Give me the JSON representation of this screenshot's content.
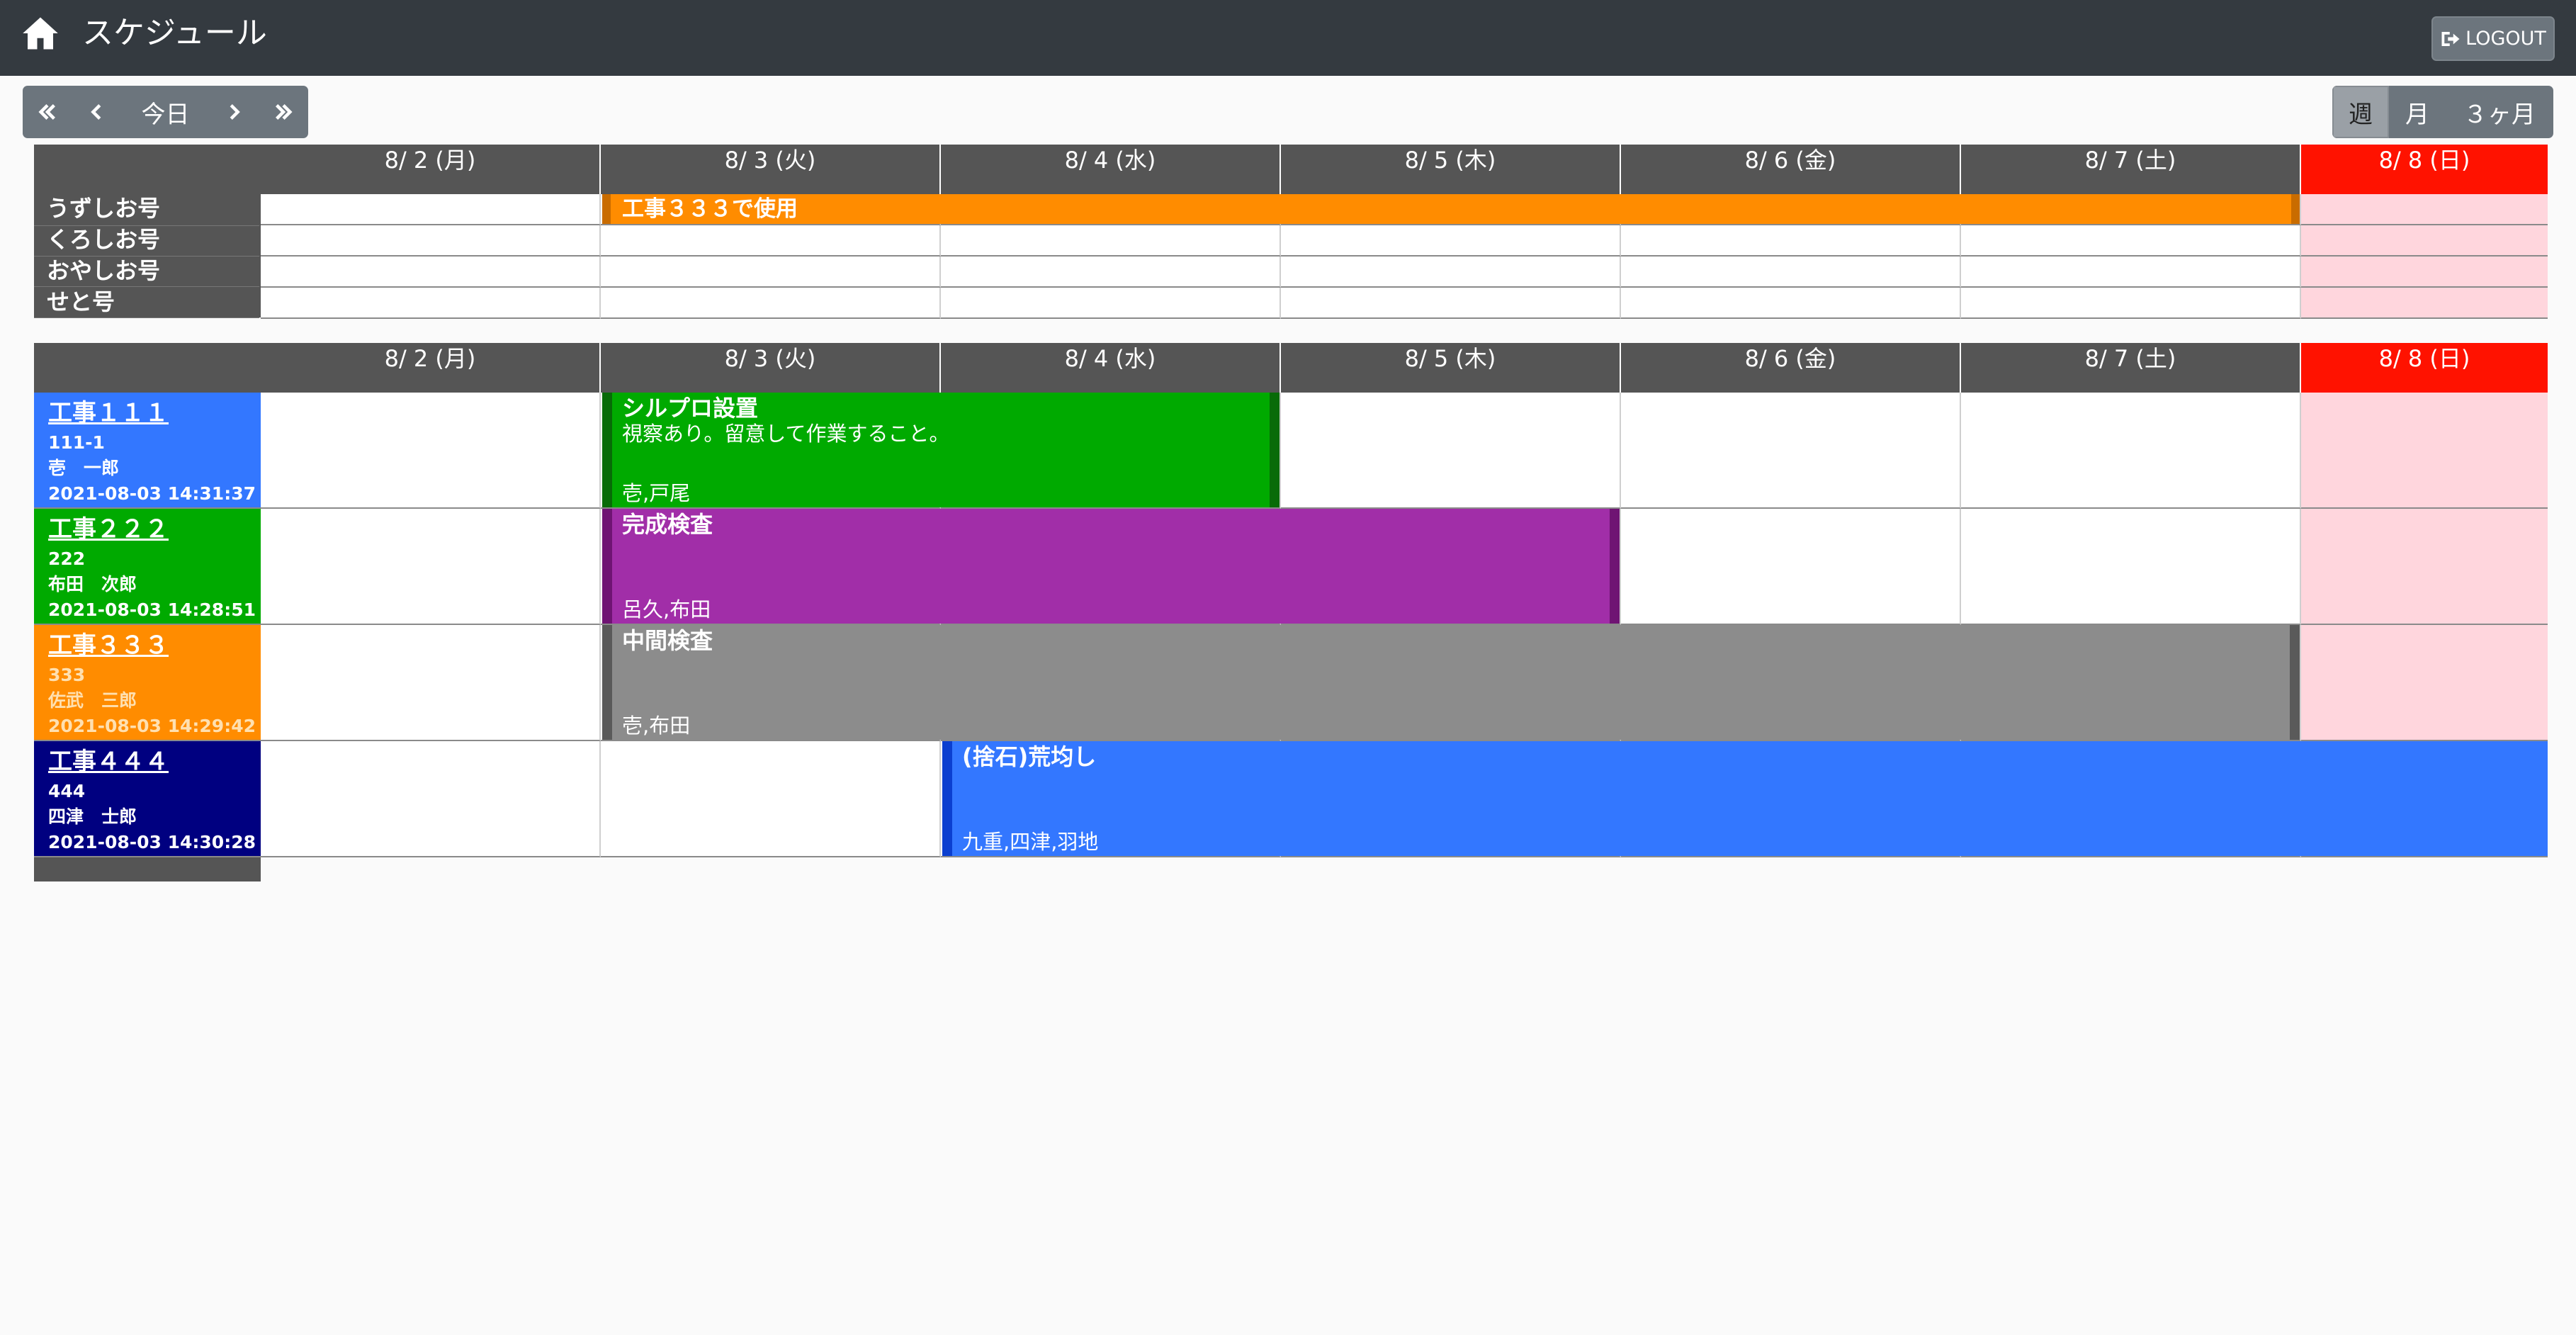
{
  "header": {
    "title": "スケジュール",
    "logout_label": "LOGOUT"
  },
  "toolbar": {
    "today_label": "今日",
    "views": [
      "週",
      "月",
      "３ヶ月"
    ],
    "active_view": "週"
  },
  "days": [
    "8/ 2 (月)",
    "8/ 3 (火)",
    "8/ 4 (水)",
    "8/ 5 (木)",
    "8/ 6 (金)",
    "8/ 7 (土)",
    "8/ 8 (日)"
  ],
  "resources": [
    "うずしお号",
    "くろしお号",
    "おやしお号",
    "せと号"
  ],
  "resource_events": [
    {
      "title": "工事３３３で使用",
      "color": "#ff8c00"
    }
  ],
  "projects": [
    {
      "name": "工事１１１",
      "code": "111-1",
      "person": "壱　一郎",
      "timestamp": "2021-08-03 14:31:37",
      "color": "#3377ff",
      "text_color": "#ffffff"
    },
    {
      "name": "工事２２２",
      "code": "222",
      "person": "布田　次郎",
      "timestamp": "2021-08-03 14:28:51",
      "color": "#00aa00",
      "text_color": "#ffffff"
    },
    {
      "name": "工事３３３",
      "code": "333",
      "person": "佐武　三郎",
      "timestamp": "2021-08-03 14:29:42",
      "color": "#ff8c00",
      "text_color": "#ffe0b0"
    },
    {
      "name": "工事４４４",
      "code": "444",
      "person": "四津　士郎",
      "timestamp": "2021-08-03 14:30:28",
      "color": "#000080",
      "text_color": "#ffffff"
    }
  ],
  "project_events": [
    {
      "title": "シルプロ設置",
      "note": "視察あり。留意して作業すること。",
      "people": "壱,戸尾",
      "color": "#00aa00"
    },
    {
      "title": "完成検査",
      "note": "",
      "people": "呂久,布田",
      "color": "#a12ea8"
    },
    {
      "title": "中間検査",
      "note": "",
      "people": "壱,布田",
      "color": "#8c8c8c"
    },
    {
      "title": "(捨石)荒均し",
      "note": "",
      "people": "九重,四津,羽地",
      "color": "#3377ff"
    }
  ]
}
